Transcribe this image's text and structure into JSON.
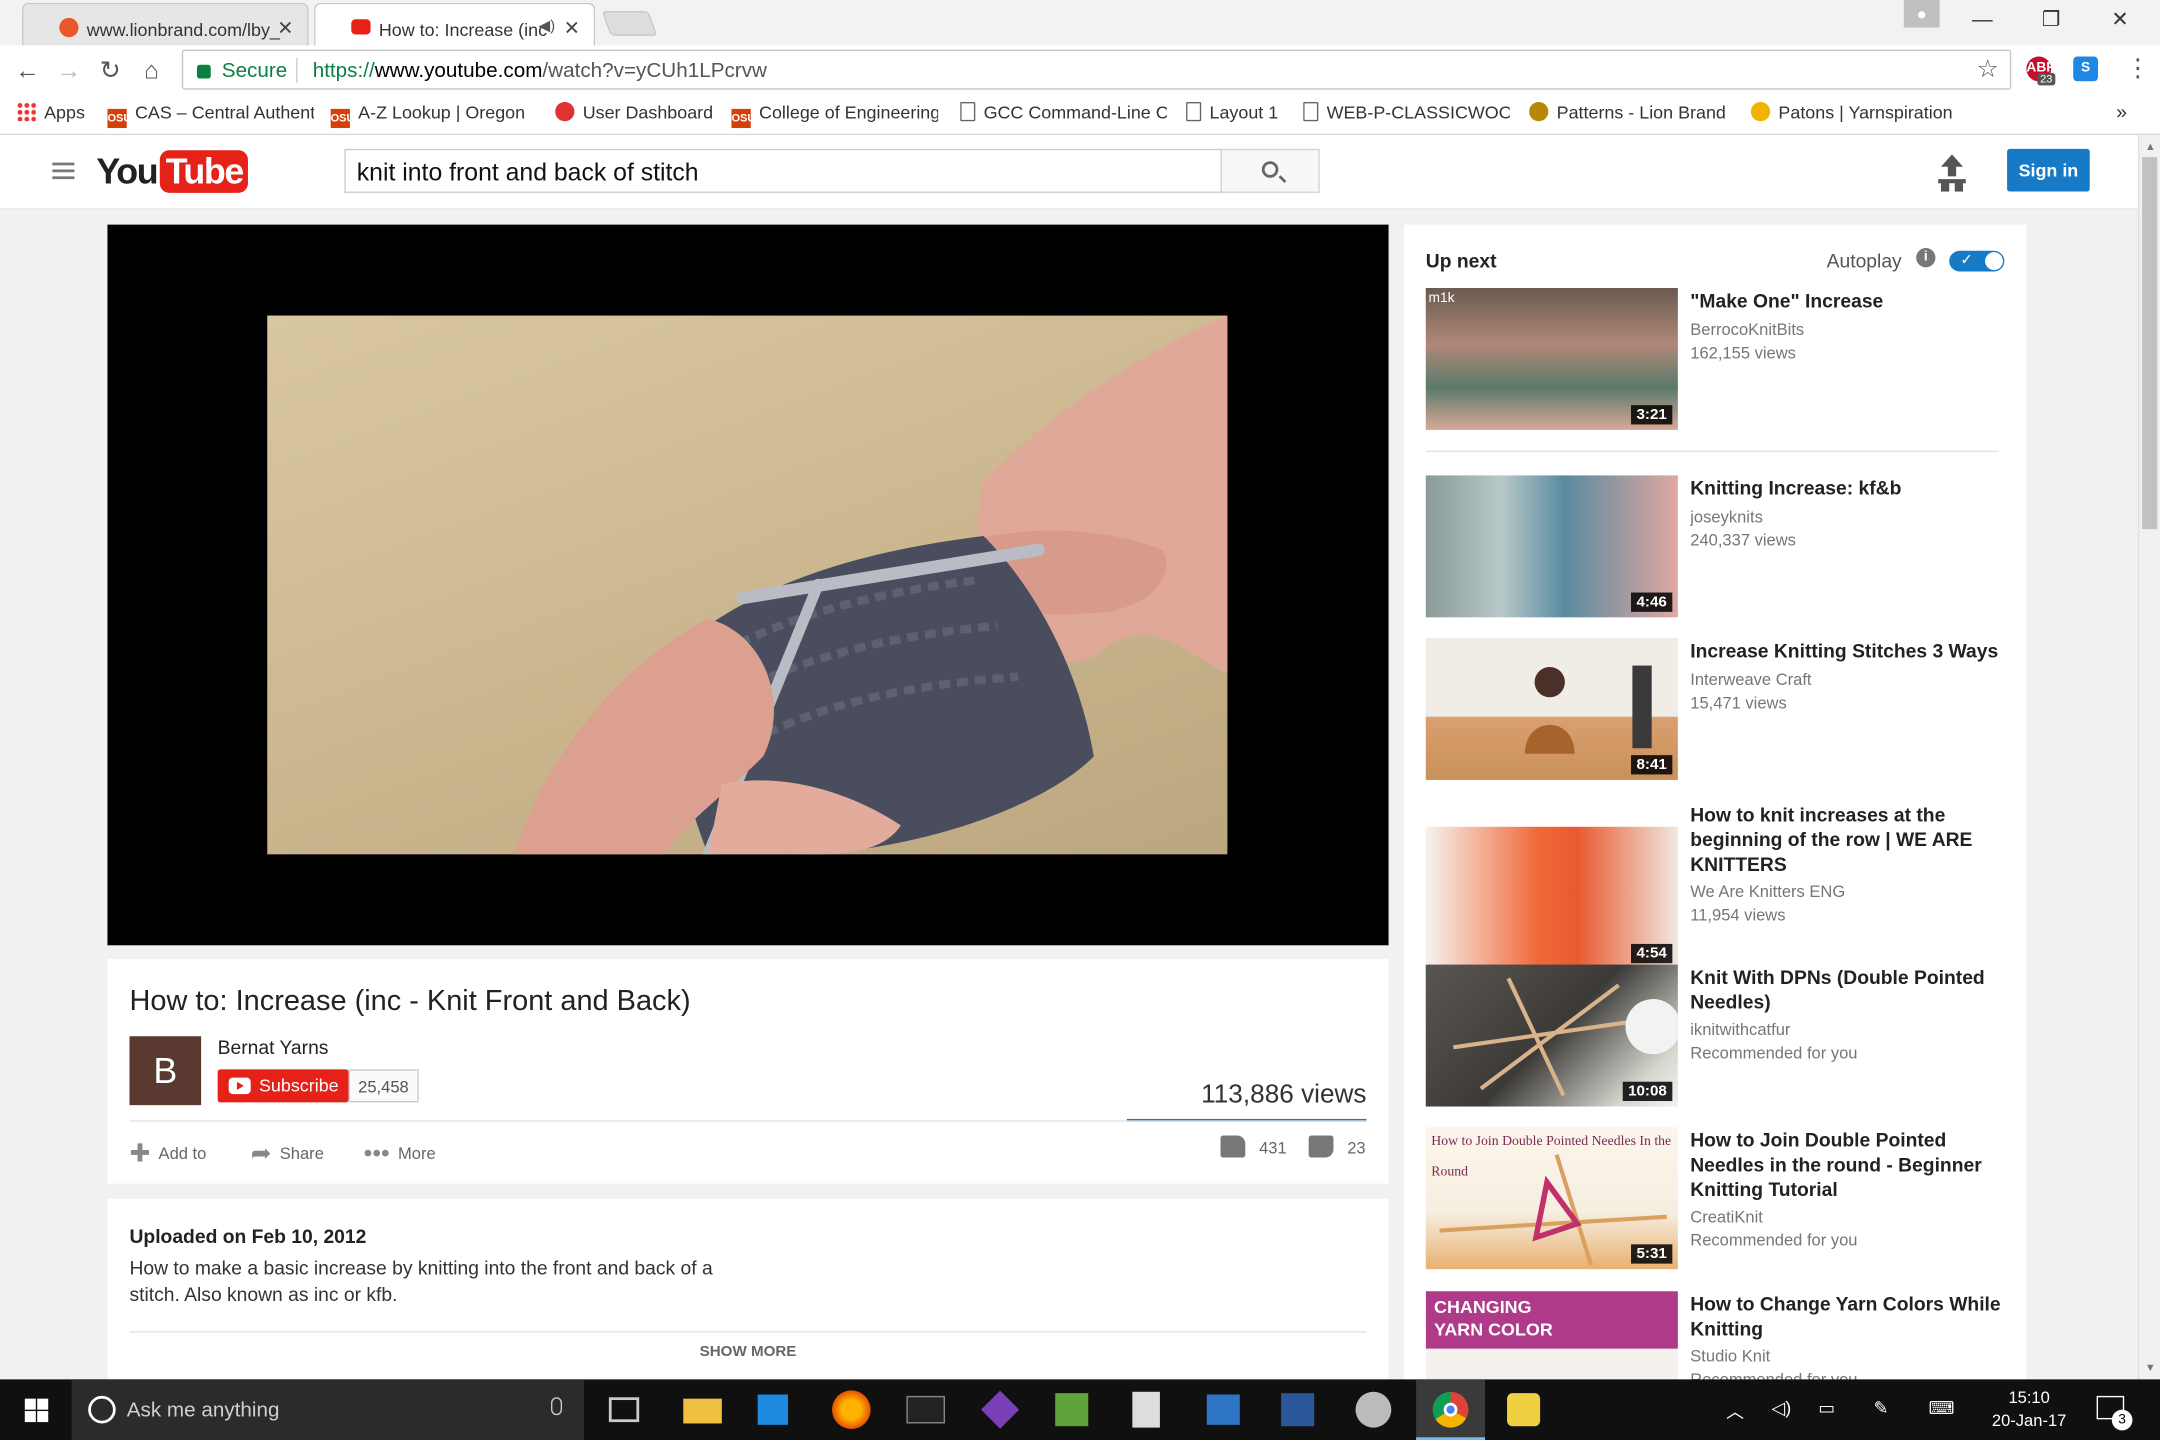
{
  "browser": {
    "tabs": [
      {
        "label": "www.lionbrand.com/lby_"
      },
      {
        "label": "How to: Increase (inc"
      }
    ],
    "secure_label": "Secure",
    "url_scheme": "https://",
    "url_host": "www.youtube.com",
    "url_path": "/watch?v=yCUh1LPcrvw",
    "abp_count": "23",
    "bookmarks_more": "»",
    "bookmarks": [
      {
        "label": "Apps",
        "icon": "apps-grid-icon"
      },
      {
        "label": "CAS – Central Authent",
        "icon": "osu-icon"
      },
      {
        "label": "A-Z Lookup | Oregon",
        "icon": "osu-icon"
      },
      {
        "label": "User Dashboard",
        "icon": "gear-icon"
      },
      {
        "label": "College of Engineering",
        "icon": "osu-coe-icon"
      },
      {
        "label": "GCC Command-Line C",
        "icon": "page-icon"
      },
      {
        "label": "Layout 1",
        "icon": "page-icon"
      },
      {
        "label": "WEB-P-CLASSICWOO",
        "icon": "page-icon"
      },
      {
        "label": "Patterns - Lion Brand",
        "icon": "lion-icon"
      },
      {
        "label": "Patons | Yarnspiration",
        "icon": "yarnspiration-icon"
      }
    ]
  },
  "youtube": {
    "logo_you": "You",
    "logo_tube": "Tube",
    "search_query": "knit into front and back of stitch",
    "signin_label": "Sign in"
  },
  "video": {
    "title": "How to: Increase (inc - Knit Front and Back)",
    "channel_initial": "B",
    "channel_name": "Bernat Yarns",
    "subscribe_label": "Subscribe",
    "subscriber_count": "25,458",
    "views": "113,886 views",
    "add_to_label": "Add to",
    "share_label": "Share",
    "more_label": "More",
    "likes": "431",
    "dislikes": "23",
    "uploaded": "Uploaded on Feb 10, 2012",
    "description": "How to make a basic increase by knitting into the front and back of a stitch. Also known as inc or kfb.",
    "show_more_label": "SHOW MORE"
  },
  "sidebar": {
    "up_next_label": "Up next",
    "autoplay_label": "Autoplay",
    "autoplay_on": true,
    "items": [
      {
        "title": "\"Make One\" Increase",
        "channel": "BerrocoKnitBits",
        "meta": "162,155 views",
        "duration": "3:21",
        "thumb_label": "m1k"
      },
      {
        "title": "Knitting Increase: kf&b",
        "channel": "joseyknits",
        "meta": "240,337 views",
        "duration": "4:46",
        "thumb_label": ""
      },
      {
        "title": "Increase Knitting Stitches 3 Ways",
        "channel": "Interweave Craft",
        "meta": "15,471 views",
        "duration": "8:41",
        "thumb_label": ""
      },
      {
        "title": "How to knit increases at the beginning of the row | WE ARE KNITTERS",
        "channel": "We Are Knitters ENG",
        "meta": "11,954 views",
        "duration": "4:54",
        "thumb_label": ""
      },
      {
        "title": "Knit With DPNs (Double Pointed Needles)",
        "channel": "iknitwithcatfur",
        "meta": "Recommended for you",
        "duration": "10:08",
        "thumb_label": ""
      },
      {
        "title": "How to Join Double Pointed Needles in the round - Beginner Knitting Tutorial",
        "channel": "CreatiKnit",
        "meta": "Recommended for you",
        "duration": "5:31",
        "thumb_label": "How to Join Double Pointed Needles In the Round"
      },
      {
        "title": "How to Change Yarn Colors While Knitting",
        "channel": "Studio Knit",
        "meta": "Recommended for you",
        "duration": "",
        "thumb_label": "CHANGING YARN COLOR"
      }
    ]
  },
  "taskbar": {
    "search_placeholder": "Ask me anything",
    "time": "15:10",
    "date": "20-Jan-17",
    "notification_count": "3"
  },
  "colors": {
    "youtube_red": "#e62117",
    "signin_blue": "#167ac6",
    "secure_green": "#0b8043"
  }
}
